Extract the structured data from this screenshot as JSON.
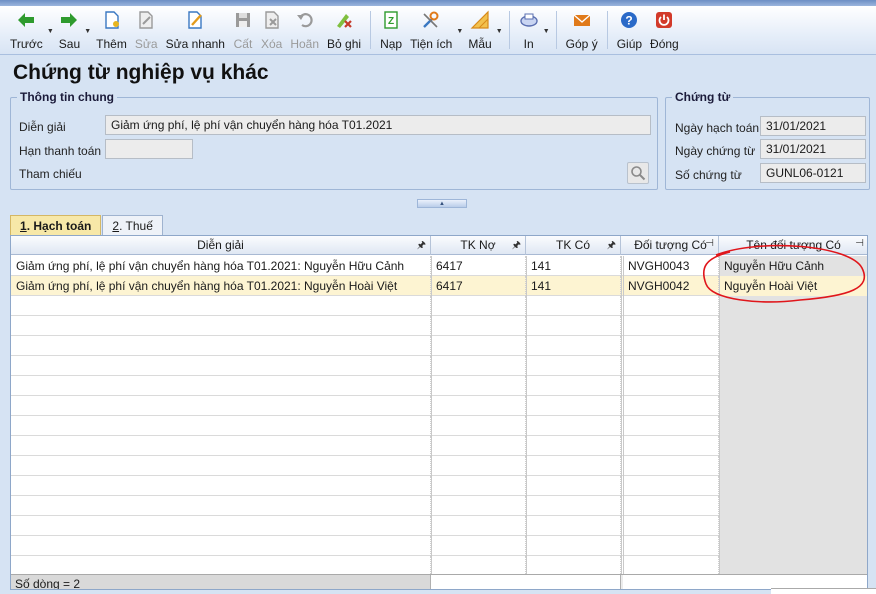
{
  "toolbar": {
    "items": [
      {
        "label": "Trước",
        "icon": "arrow-left-icon",
        "color": "#2e9b2e",
        "disabled": false,
        "caret": true
      },
      {
        "label": "Sau",
        "icon": "arrow-right-icon",
        "color": "#2e9b2e",
        "disabled": false,
        "caret": true
      },
      {
        "label": "Thêm",
        "icon": "new-document-icon",
        "color": "#3a78c2",
        "disabled": false
      },
      {
        "label": "Sửa",
        "icon": "edit-document-icon",
        "color": "#9a9a9a",
        "disabled": true
      },
      {
        "label": "Sửa nhanh",
        "icon": "quick-edit-icon",
        "color": "#3a78c2",
        "disabled": false
      },
      {
        "label": "Cất",
        "icon": "save-icon",
        "color": "#9a9a9a",
        "disabled": true
      },
      {
        "label": "Xóa",
        "icon": "delete-icon",
        "color": "#9a9a9a",
        "disabled": true
      },
      {
        "label": "Hoãn",
        "icon": "undo-icon",
        "color": "#9a9a9a",
        "disabled": true
      },
      {
        "label": "Bỏ ghi",
        "icon": "unpost-icon",
        "color": "#c43a2a",
        "disabled": false
      },
      {
        "label": "Nạp",
        "icon": "reload-icon",
        "color": "#2e9b2e",
        "disabled": false
      },
      {
        "label": "Tiện ích",
        "icon": "tools-icon",
        "color": "#3a78c2",
        "disabled": false,
        "caret": true
      },
      {
        "label": "Mẫu",
        "icon": "template-icon",
        "color": "#d88a1a",
        "disabled": false,
        "caret": true
      },
      {
        "label": "In",
        "icon": "print-icon",
        "color": "#5a6fb0",
        "disabled": false,
        "caret": true
      },
      {
        "label": "Góp ý",
        "icon": "mail-icon",
        "color": "#e07a1a",
        "disabled": false
      },
      {
        "label": "Giúp",
        "icon": "help-icon",
        "color": "#2a6ac8",
        "disabled": false
      },
      {
        "label": "Đóng",
        "icon": "power-icon",
        "color": "#d23a2a",
        "disabled": false
      }
    ]
  },
  "page": {
    "title": "Chứng từ nghiệp vụ khác"
  },
  "general_info": {
    "legend": "Thông tin chung",
    "dien_giai_label": "Diễn giải",
    "dien_giai_value": "Giảm ứng phí, lệ phí vận chuyển hàng hóa T01.2021",
    "han_thanh_toan_label": "Hạn thanh toán",
    "han_thanh_toan_value": "",
    "tham_chieu_label": "Tham chiếu"
  },
  "voucher": {
    "legend": "Chứng từ",
    "ngay_hach_toan_label": "Ngày hạch toán",
    "ngay_hach_toan_value": "31/01/2021",
    "ngay_chung_tu_label": "Ngày chứng từ",
    "ngay_chung_tu_value": "31/01/2021",
    "so_chung_tu_label": "Số chứng từ",
    "so_chung_tu_value": "GUNL06-0121"
  },
  "tabs": [
    {
      "key": "1",
      "label": ". Hạch toán",
      "active": true
    },
    {
      "key": "2",
      "label": ". Thuế",
      "active": false
    }
  ],
  "grid": {
    "headers": [
      "Diễn giải",
      "TK Nợ",
      "TK Có",
      "Đối tượng Có",
      "Tên đối tượng Có"
    ],
    "rows": [
      {
        "dien_giai": "Giảm ứng phí, lệ phí vận chuyển hàng hóa T01.2021: Nguyễn Hữu Cảnh",
        "tk_no": "6417",
        "tk_co": "141",
        "doi_tuong": "NVGH0043",
        "ten_doi_tuong": "Nguyễn Hữu Cảnh"
      },
      {
        "dien_giai": "Giảm ứng phí, lệ phí vận chuyển hàng hóa T01.2021: Nguyễn Hoài Việt",
        "tk_no": "6417",
        "tk_co": "141",
        "doi_tuong": "NVGH0042",
        "ten_doi_tuong": "Nguyễn Hoài Việt"
      }
    ],
    "footer": "Số dòng = 2"
  },
  "colors": {
    "selected_row": "#fdf4d2",
    "active_tab": "#f7e8a8",
    "annotation": "#e0161b"
  }
}
